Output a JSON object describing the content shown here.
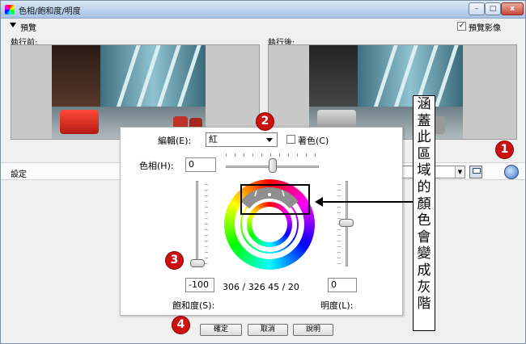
{
  "window": {
    "title": "色相/飽和度/明度",
    "min_label": "–",
    "max_label": "□",
    "close_label": "x"
  },
  "preview": {
    "section_label": "預覽",
    "show_label": "預覽影像",
    "show_checked_mark": "✓",
    "before_label": "執行前:",
    "after_label": "執行後:"
  },
  "settings": {
    "label": "設定"
  },
  "editor": {
    "edit_label": "編輯(E):",
    "edit_value": "紅",
    "colorize_label": "著色(C)",
    "hue_label": "色相(H):",
    "hue_value": "0",
    "saturation_value": "-100",
    "saturation_label": "飽和度(S):",
    "lightness_value": "0",
    "lightness_label": "明度(L):",
    "range_readout": "306 / 326  45 / 20"
  },
  "buttons": {
    "ok": "確定",
    "cancel": "取消",
    "help": "說明"
  },
  "badges": [
    "1",
    "2",
    "3",
    "4"
  ],
  "callout": {
    "chars": [
      "涵",
      "蓋",
      "此",
      "區",
      "域",
      "的",
      "顏",
      "色",
      "會",
      "變",
      "成",
      "灰",
      "階"
    ]
  },
  "colors": {
    "badge_red": "#cc1111",
    "titlebar": "#b9d1ea"
  }
}
